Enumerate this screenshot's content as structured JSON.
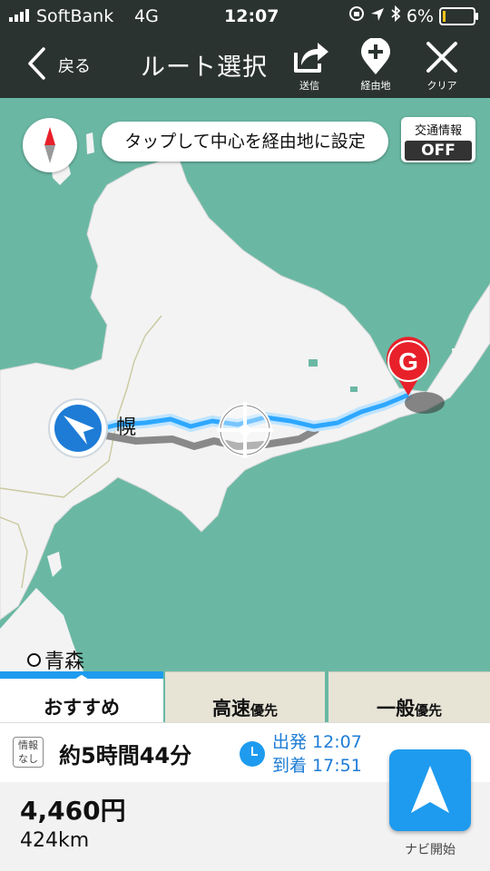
{
  "status_bar": {
    "carrier": "SoftBank",
    "network": "4G",
    "time": "12:07",
    "battery": "6%"
  },
  "header": {
    "back_label": "戻る",
    "title": "ルート選択",
    "send_label": "送信",
    "waypoint_label": "経由地",
    "clear_label": "クリア"
  },
  "map": {
    "hint": "タップして中心を経由地に設定",
    "traffic_label": "交通情報",
    "traffic_state": "OFF",
    "city_label": "幌",
    "aomori_label": "青森",
    "goal_label": "G",
    "colors": {
      "sea": "#6ab8a4",
      "land": "#f3f3f3",
      "route": "#2ea7ff",
      "goal": "#e8202a"
    }
  },
  "tabs": [
    {
      "label": "おすすめ",
      "suffix": ""
    },
    {
      "label": "高速",
      "suffix": "優先"
    },
    {
      "label": "一般",
      "suffix": "優先"
    }
  ],
  "route": {
    "info_badge": "情報なし",
    "duration": "約5時間44分",
    "depart": "出発 12:07",
    "arrive": "到着 17:51",
    "price": "4,460円",
    "distance": "424km",
    "start_nav_label": "ナビ開始"
  },
  "accent_color": "#1e9bef"
}
